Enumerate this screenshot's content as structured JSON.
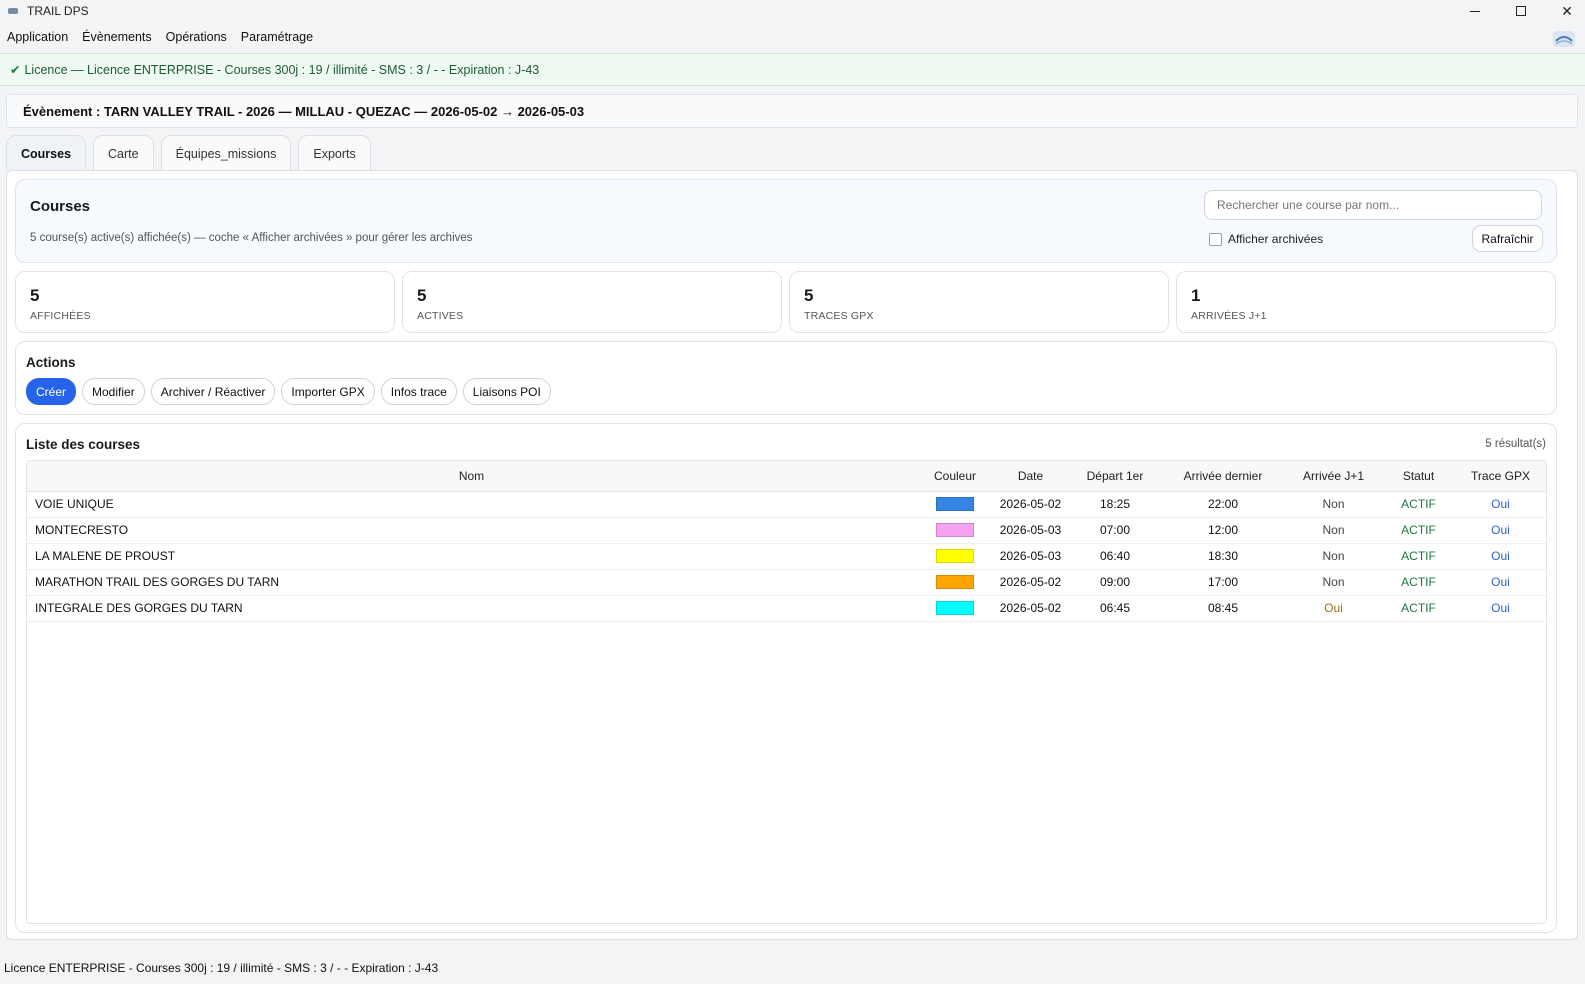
{
  "window": {
    "title": "TRAIL DPS"
  },
  "menu": [
    "Application",
    "Évènements",
    "Opérations",
    "Paramétrage"
  ],
  "license_banner": "Licence — Licence ENTERPRISE - Courses 300j : 19 / illimité - SMS : 3 / - - Expiration : J-43",
  "event_header": "Évènement : TARN VALLEY TRAIL - 2026 — MILLAU - QUEZAC — 2026-05-02 → 2026-05-03",
  "tabs": [
    {
      "label": "Courses",
      "active": true
    },
    {
      "label": "Carte",
      "active": false
    },
    {
      "label": "Équipes_missions",
      "active": false
    },
    {
      "label": "Exports",
      "active": false
    }
  ],
  "courses_header": {
    "title": "Courses",
    "subtitle": "5 course(s) active(s) affichée(s) — coche « Afficher archivées » pour gérer les archives",
    "search_placeholder": "Rechercher une course par nom...",
    "show_archived_label": "Afficher archivées",
    "show_archived_checked": false,
    "refresh_label": "Rafraîchir"
  },
  "stats": [
    {
      "value": "5",
      "label": "AFFICHÉES"
    },
    {
      "value": "5",
      "label": "ACTIVES"
    },
    {
      "value": "5",
      "label": "TRACES GPX"
    },
    {
      "value": "1",
      "label": "ARRIVÉES J+1"
    }
  ],
  "actions": {
    "title": "Actions",
    "buttons": [
      "Créer",
      "Modifier",
      "Archiver / Réactiver",
      "Importer GPX",
      "Infos trace",
      "Liaisons POI"
    ]
  },
  "list": {
    "title": "Liste des courses",
    "count": "5 résultat(s)",
    "columns": [
      "Nom",
      "Couleur",
      "Date",
      "Départ 1er",
      "Arrivée dernier",
      "Arrivée J+1",
      "Statut",
      "Trace GPX"
    ],
    "rows": [
      {
        "nom": "VOIE UNIQUE",
        "couleur": "#3584e4",
        "date": "2026-05-02",
        "depart": "18:25",
        "arrivee": "22:00",
        "j1": "Non",
        "statut": "ACTIF",
        "gpx": "Oui"
      },
      {
        "nom": "MONTECRESTO",
        "couleur": "#f5a3f0",
        "date": "2026-05-03",
        "depart": "07:00",
        "arrivee": "12:00",
        "j1": "Non",
        "statut": "ACTIF",
        "gpx": "Oui"
      },
      {
        "nom": "LA MALENE DE PROUST",
        "couleur": "#ffff00",
        "date": "2026-05-03",
        "depart": "06:40",
        "arrivee": "18:30",
        "j1": "Non",
        "statut": "ACTIF",
        "gpx": "Oui"
      },
      {
        "nom": "MARATHON TRAIL DES GORGES DU TARN",
        "couleur": "#ffa500",
        "date": "2026-05-02",
        "depart": "09:00",
        "arrivee": "17:00",
        "j1": "Non",
        "statut": "ACTIF",
        "gpx": "Oui"
      },
      {
        "nom": "INTEGRALE DES GORGES DU TARN",
        "couleur": "#00ffff",
        "date": "2026-05-02",
        "depart": "06:45",
        "arrivee": "08:45",
        "j1": "Oui",
        "statut": "ACTIF",
        "gpx": "Oui"
      }
    ]
  },
  "status_bar": "Licence ENTERPRISE - Courses 300j : 19 / illimité - SMS : 3 / - - Expiration : J-43",
  "colors": {
    "primary": "#2563eb",
    "status_actif": "#207540",
    "gpx_oui": "#2b63c9",
    "j1_oui": "#a36a14"
  }
}
